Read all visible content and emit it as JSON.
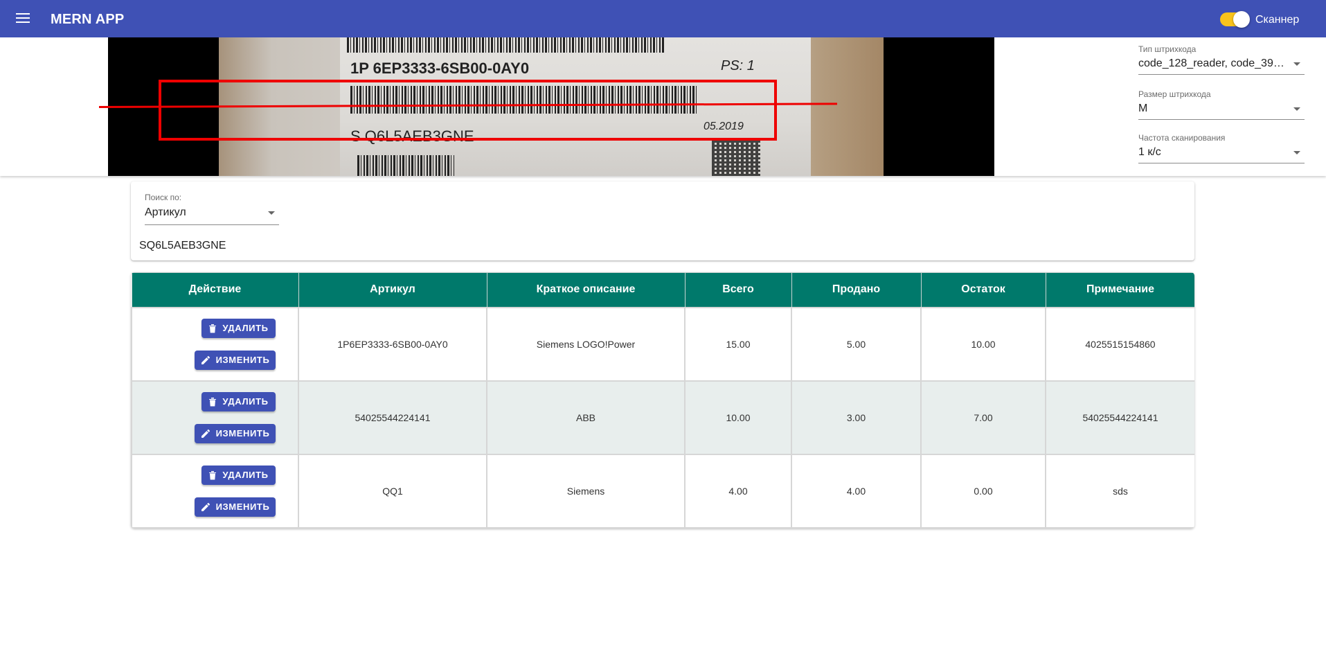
{
  "appbar": {
    "title": "MERN APP",
    "scanner_label": "Сканнер",
    "scanner_on": true,
    "accent": "#3f51b5",
    "switch_color": "#f9c31b"
  },
  "camera": {
    "photo_text": {
      "line1": "1P 6EP3333-6SB00-0AY0",
      "ps": "PS: 1",
      "serial": "S Q6L5AEB3GNE",
      "date": "05.2019"
    }
  },
  "settings": {
    "barcode_type": {
      "label": "Тип штрихкода",
      "value": "code_128_reader, code_39_r..."
    },
    "barcode_size": {
      "label": "Размер штрихкода",
      "value": "M"
    },
    "scan_rate": {
      "label": "Частота сканирования",
      "value": "1 к/с"
    }
  },
  "search": {
    "by_label": "Поиск по:",
    "by_value": "Артикул",
    "value": "SQ6L5AEB3GNE"
  },
  "table": {
    "header_color": "#00796b",
    "columns": [
      "Действие",
      "Артикул",
      "Краткое описание",
      "Всего",
      "Продано",
      "Остаток",
      "Примечание"
    ],
    "delete_label": "УДАЛИТЬ",
    "edit_label": "ИЗМЕНИТЬ",
    "rows": [
      {
        "article": "1P6EP3333-6SB00-0AY0",
        "description": "Siemens LOGO!Power",
        "total": "15.00",
        "sold": "5.00",
        "remaining": "10.00",
        "note": "4025515154860"
      },
      {
        "article": "54025544224141",
        "description": "ABB",
        "total": "10.00",
        "sold": "3.00",
        "remaining": "7.00",
        "note": "54025544224141"
      },
      {
        "article": "QQ1",
        "description": "Siemens",
        "total": "4.00",
        "sold": "4.00",
        "remaining": "0.00",
        "note": "sds"
      }
    ]
  }
}
